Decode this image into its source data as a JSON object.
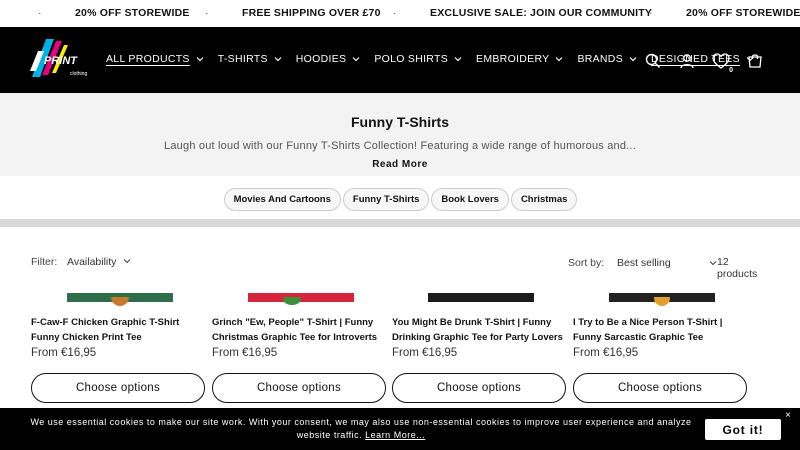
{
  "announcement": {
    "messages": [
      "20% OFF STOREWIDE",
      "FREE SHIPPING OVER £70",
      "EXCLUSIVE SALE: JOIN OUR COMMUNITY",
      "20% OFF STOREWIDE"
    ],
    "separator": "·"
  },
  "header": {
    "logo_text": "PRINT",
    "logo_sub": "clothing",
    "nav": [
      {
        "label": "ALL PRODUCTS",
        "active": true
      },
      {
        "label": "T-SHIRTS"
      },
      {
        "label": "HOODIES"
      },
      {
        "label": "POLO SHIRTS"
      },
      {
        "label": "EMBROIDERY"
      },
      {
        "label": "BRANDS"
      },
      {
        "label": "DESIGNED TEES",
        "active": true
      }
    ],
    "wishlist_count": "0",
    "icons": [
      "search-icon",
      "account-icon",
      "wishlist-icon",
      "cart-icon"
    ]
  },
  "collection": {
    "title": "Funny T-Shirts",
    "description": "Laugh out loud with our Funny T-Shirts Collection! Featuring a wide range of humorous and...",
    "read_more": "Read More",
    "chips": [
      "Movies And Cartoons",
      "Funny T-Shirts",
      "Book Lovers",
      "Christmas"
    ]
  },
  "toolbar": {
    "filter_label": "Filter:",
    "availability": "Availability",
    "sort_label": "Sort by:",
    "sort_value": "Best selling",
    "product_count": "12 products"
  },
  "products": [
    {
      "title": "F-Caw-F Chicken Graphic T-Shirt Funny Chicken Print Tee",
      "price": "From €16,95",
      "button": "Choose options",
      "color": "#2e6e4a"
    },
    {
      "title": "Grinch \"Ew, People\" T-Shirt | Funny Christmas Graphic Tee for Introverts",
      "price": "From €16,95",
      "button": "Choose options",
      "color": "#d6253a"
    },
    {
      "title": "You Might Be Drunk T-Shirt | Funny Drinking Graphic Tee for Party Lovers",
      "price": "From €16,95",
      "button": "Choose options",
      "color": "#1c1c1c"
    },
    {
      "title": "I Try to Be a Nice Person T-Shirt | Funny Sarcastic Graphic Tee",
      "price": "From €16,95",
      "button": "Choose options",
      "color": "#222222"
    }
  ],
  "cookie": {
    "text": "We use essential cookies to make our site work. With your consent, we may also use non-essential cookies to improve user experience and analyze website traffic.",
    "link": "Learn More...",
    "accept": "Got it!",
    "close": "×"
  },
  "colors": {
    "header_bg": "#000000",
    "banner_bg": "#f3f3f3",
    "accent_logo": [
      "#00b2e3",
      "#e6007e",
      "#ffed00"
    ]
  }
}
